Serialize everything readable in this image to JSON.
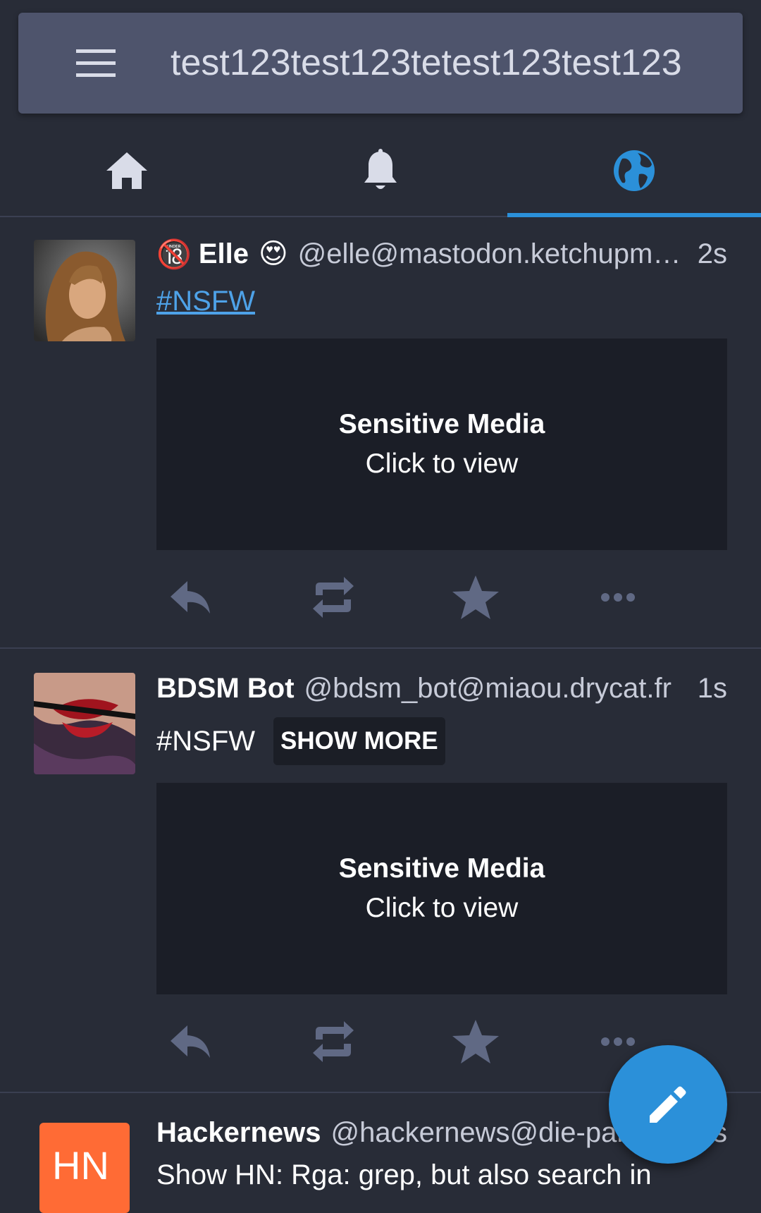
{
  "app_bar": {
    "menu_icon": "hamburger-menu-icon",
    "account_title": "test123test123tetest123test123"
  },
  "tabs": [
    {
      "name": "home",
      "icon": "home-icon",
      "active": false
    },
    {
      "name": "notifications",
      "icon": "bell-icon",
      "active": false
    },
    {
      "name": "federated",
      "icon": "globe-icon",
      "active": true
    }
  ],
  "colors": {
    "background": "#282c37",
    "app_bar": "#4e546c",
    "accent": "#2b90d9",
    "link": "#4ea2e8",
    "action_icon": "#606984",
    "media_placeholder": "#1b1e27"
  },
  "statuses": [
    {
      "avatar": "photo of a woman with wavy hair",
      "display_name_prefix_emoji": "🔞",
      "display_name": "Elle",
      "display_name_suffix_emoji": "😍",
      "account": "@elle@mastodon.ketchupmoustache.com",
      "time": "2s",
      "hashtag": "#NSFW",
      "media": {
        "title": "Sensitive Media",
        "subtitle": "Click to view"
      }
    },
    {
      "avatar": "close-up photo of lips with gag",
      "display_name": "BDSM Bot",
      "account": "@bdsm_bot@miaou.drycat.fr",
      "time": "1s",
      "hashtag": "#NSFW",
      "show_more_label": "SHOW MORE",
      "media": {
        "title": "Sensitive Media",
        "subtitle": "Click to view"
      }
    },
    {
      "avatar_text": "HN",
      "display_name": "Hackernews",
      "account": "@hackernews@die-partei.social",
      "time": "5s",
      "text": "Show HN: Rga: grep, but also search in"
    }
  ],
  "action_icons": [
    "reply-icon",
    "boost-icon",
    "favourite-icon",
    "more-icon"
  ],
  "fab": {
    "icon": "pencil-icon",
    "label": "compose"
  }
}
